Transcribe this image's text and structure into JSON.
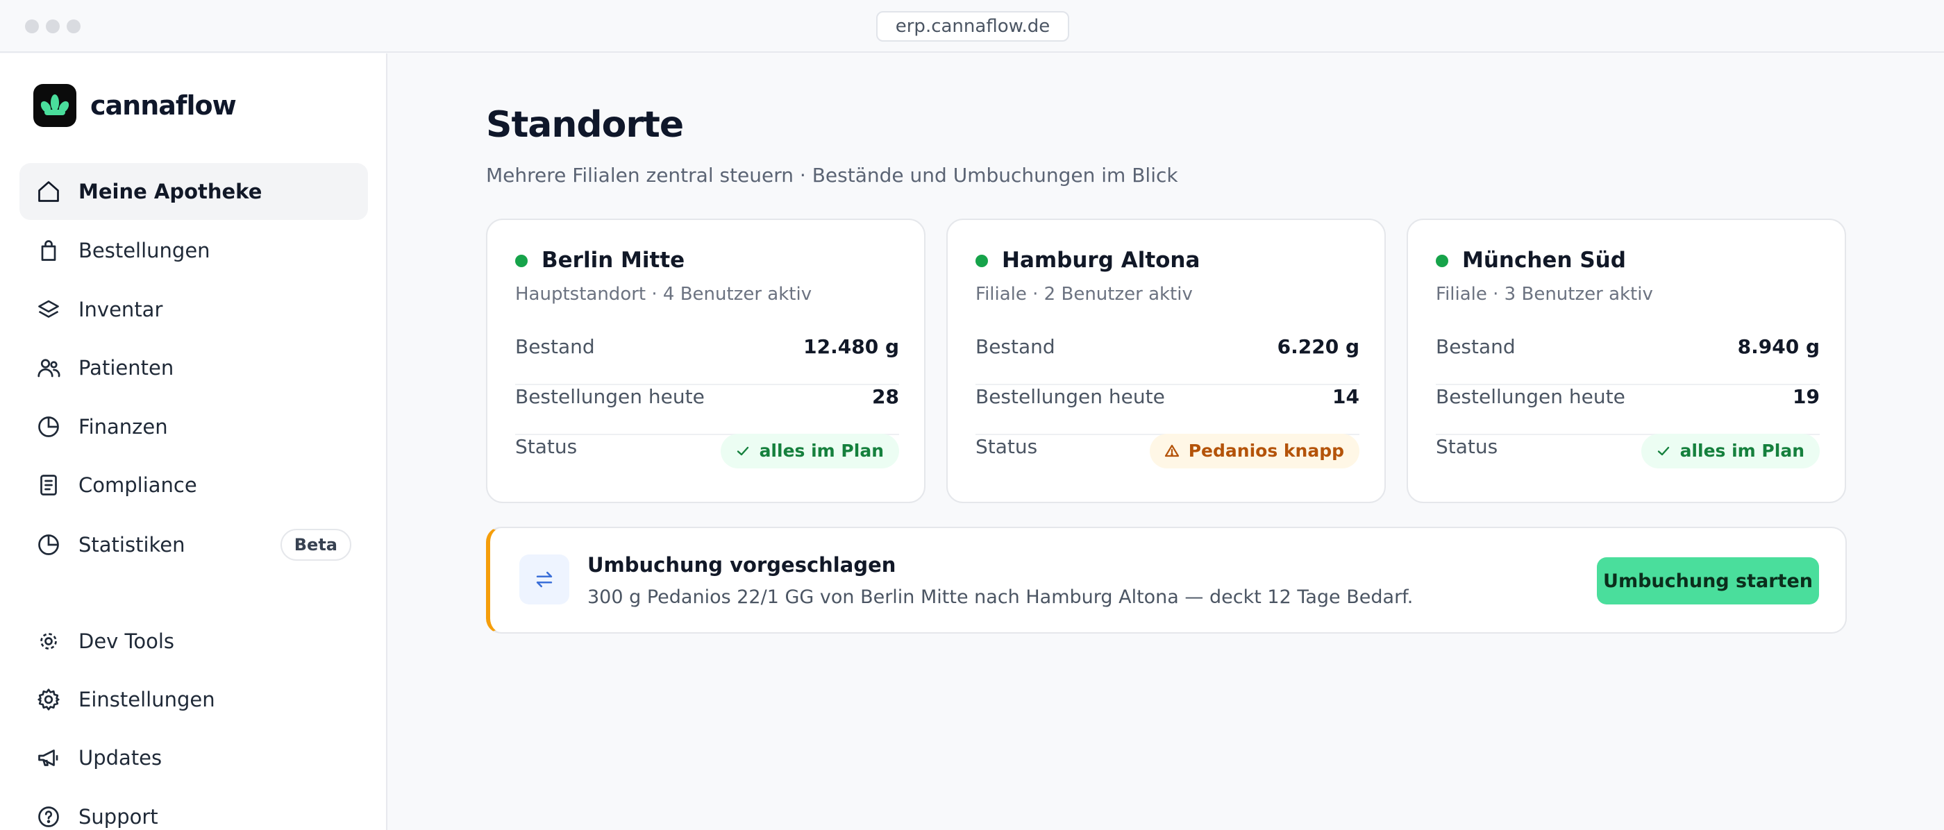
{
  "browser": {
    "url": "erp.cannaflow.de"
  },
  "brand": {
    "name": "cannaflow"
  },
  "sidebar": {
    "items": [
      {
        "label": "Meine Apotheke",
        "icon": "home-icon",
        "active": true
      },
      {
        "label": "Bestellungen",
        "icon": "shopping-bag-icon"
      },
      {
        "label": "Inventar",
        "icon": "layers-icon"
      },
      {
        "label": "Patienten",
        "icon": "users-icon"
      },
      {
        "label": "Finanzen",
        "icon": "pie-chart-icon"
      },
      {
        "label": "Compliance",
        "icon": "document-icon"
      },
      {
        "label": "Statistiken",
        "icon": "pie-chart-icon",
        "badge": "Beta"
      },
      {
        "label": "Dev Tools",
        "icon": "dev-tools-icon"
      },
      {
        "label": "Einstellungen",
        "icon": "gear-icon"
      },
      {
        "label": "Updates",
        "icon": "megaphone-icon"
      },
      {
        "label": "Support",
        "icon": "help-circle-icon"
      }
    ]
  },
  "main": {
    "title": "Standorte",
    "subtitle": "Mehrere Filialen zentral steuern · Bestände und Umbuchungen im Blick",
    "locations": [
      {
        "name": "Berlin Mitte",
        "meta": "Hauptstandort · 4 Benutzer aktiv",
        "stock_label": "Bestand",
        "stock": "12.480 g",
        "orders_label": "Bestellungen heute",
        "orders": "28",
        "status_label": "Status",
        "status": "alles im Plan",
        "status_type": "ok"
      },
      {
        "name": "Hamburg Altona",
        "meta": "Filiale · 2 Benutzer aktiv",
        "stock_label": "Bestand",
        "stock": "6.220 g",
        "orders_label": "Bestellungen heute",
        "orders": "14",
        "status_label": "Status",
        "status": "Pedanios knapp",
        "status_type": "warn"
      },
      {
        "name": "München Süd",
        "meta": "Filiale · 3 Benutzer aktiv",
        "stock_label": "Bestand",
        "stock": "8.940 g",
        "orders_label": "Bestellungen heute",
        "orders": "19",
        "status_label": "Status",
        "status": "alles im Plan",
        "status_type": "ok"
      }
    ],
    "suggestion": {
      "title": "Umbuchung vorgeschlagen",
      "text": "300 g Pedanios 22/1 GG von Berlin Mitte nach Hamburg Altona — deckt 12 Tage Bedarf.",
      "button": "Umbuchung starten"
    }
  },
  "colors": {
    "accent_green": "#4ade9c",
    "status_ok": "#16a34a",
    "status_warn": "#b45309",
    "suggestion_border": "#f59e0b"
  }
}
